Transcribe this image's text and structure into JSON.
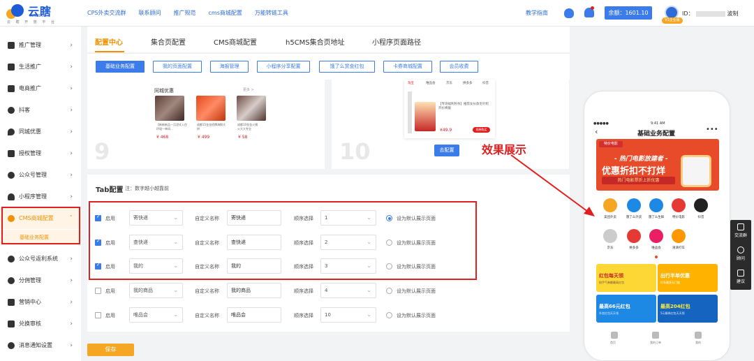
{
  "brand": {
    "name": "云瞎",
    "english": "YUNXIAN",
    "tagline": "云 瞎 开 放 平 台"
  },
  "topnav": [
    "CPS外卖交流群",
    "联系顾问",
    "推广规范",
    "cms商城配置",
    "万能转链工具"
  ],
  "header": {
    "manual": "教学指南",
    "balance": "余额：1601.10",
    "uid_prefix": "ID：",
    "uid_suffix": "波制",
    "badge": "V1企业版"
  },
  "colors": {
    "accent": "#f29100",
    "primary": "#3b7bea",
    "alert": "#e02020"
  },
  "sidebar": {
    "items": [
      {
        "label": "推广管理",
        "icon": "grid-icon"
      },
      {
        "label": "生活推广",
        "icon": "calendar-icon"
      },
      {
        "label": "电商推广",
        "icon": "cart-icon"
      },
      {
        "label": "抖客",
        "icon": "tiktok-icon"
      },
      {
        "label": "同城优惠",
        "icon": "location-icon"
      },
      {
        "label": "授权管理",
        "icon": "key-icon"
      },
      {
        "label": "公众号管理",
        "icon": "wechat-icon"
      },
      {
        "label": "小程序管理",
        "icon": "user-icon"
      },
      {
        "label": "CMS商城配置",
        "icon": "store-icon"
      },
      {
        "label": "公众号返利系统",
        "icon": "wechat-icon"
      },
      {
        "label": "分佣管理",
        "icon": "money-icon"
      },
      {
        "label": "营销中心",
        "icon": "gift-icon"
      },
      {
        "label": "兑换审核",
        "icon": "stamp-icon"
      },
      {
        "label": "消息通知设置",
        "icon": "message-icon"
      }
    ],
    "sub_item": "基础业务配置"
  },
  "tabs": [
    "配置中心",
    "集合页配置",
    "CMS商城配置",
    "h5CMS集合页地址",
    "小程序页面路径"
  ],
  "subnav": [
    "基础业务配置",
    "我的页面配置",
    "海报管理",
    "小程序分享配置",
    "饿了么赏金红包",
    "卡券商城配置",
    "会员收费"
  ],
  "cards": {
    "card9": {
      "number": "9",
      "title": "同城优惠",
      "more": "更多 >",
      "products": [
        {
          "text": "【新新新品—沉浸式入住环境—单间...",
          "price": "¥ 468"
        },
        {
          "text": "成都15金金招牌海鲜大拼",
          "price": "¥ 499"
        },
        {
          "text": "成都10金金火锅火大大专业",
          "price": "¥ 58"
        }
      ]
    },
    "card10": {
      "number": "10",
      "tabs": [
        "淘宝",
        "唯品会",
        "京东",
        "拼多多",
        "抖音"
      ],
      "product_text": "【专场福利秒杀】推荐女长款毛针织开衫棉服",
      "price": "¥49.9",
      "buy": "领券购买",
      "button": "去配置"
    }
  },
  "tab_config": {
    "title": "Tab配置",
    "note": "注：数字越小越靠前",
    "enable_label": "启用",
    "custom_name_label": "自定义名称",
    "order_label": "顺序选择",
    "default_label": "设为默认展示页面",
    "rows": [
      {
        "enabled": true,
        "type": "寄快递",
        "name": "寄快递",
        "order": "1",
        "default": true
      },
      {
        "enabled": true,
        "type": "查快递",
        "name": "查快递",
        "order": "2",
        "default": false
      },
      {
        "enabled": true,
        "type": "我的",
        "name": "我的",
        "order": "3",
        "default": false
      },
      {
        "enabled": false,
        "type": "我的商品",
        "name": "我的商品",
        "order": "4",
        "default": false
      },
      {
        "enabled": false,
        "type": "唯品会",
        "name": "唯品会",
        "order": "10",
        "default": false
      }
    ],
    "save": "保存"
  },
  "annotation": "效果展示",
  "phone": {
    "status": "●●●●● ",
    "time": "9:41 AM",
    "title": "基础业务配置",
    "banner": {
      "tag": "特价电影",
      "line1": "- 热门电影放建者 -",
      "line2": "优惠折扣不打烊",
      "line3": "热门电影票折上折优惠"
    },
    "grid": [
      {
        "label": "美团外卖",
        "color": "#f5a623"
      },
      {
        "label": "饿了么外卖",
        "color": "#1e88e5"
      },
      {
        "label": "饿了么生鲜",
        "color": "#1e88e5"
      },
      {
        "label": "特价电影",
        "color": "#e53935"
      },
      {
        "label": "抖音",
        "color": "#222222"
      },
      {
        "label": "京东",
        "color": "#cccccc"
      },
      {
        "label": "拼多多",
        "color": "#e53935"
      },
      {
        "label": "唯品会",
        "color": "#e91e63"
      },
      {
        "label": "滴滴打车",
        "color": "#ff9800"
      }
    ],
    "promos": [
      {
        "title": "红包每天领",
        "sub": "抢手气券额最高红包"
      },
      {
        "title": "出行半单优惠",
        "sub": "打车最多无门槛"
      },
      {
        "title": "最高66元红包",
        "sub": "外卖红包天天领"
      },
      {
        "title": "最高204红包",
        "sub": "5元餐券红包天天领"
      }
    ],
    "tabbar": [
      "首页",
      "我的订单",
      "我的"
    ]
  },
  "float": [
    {
      "label": "交流群"
    },
    {
      "label": "顾问"
    },
    {
      "label": "建议"
    }
  ]
}
